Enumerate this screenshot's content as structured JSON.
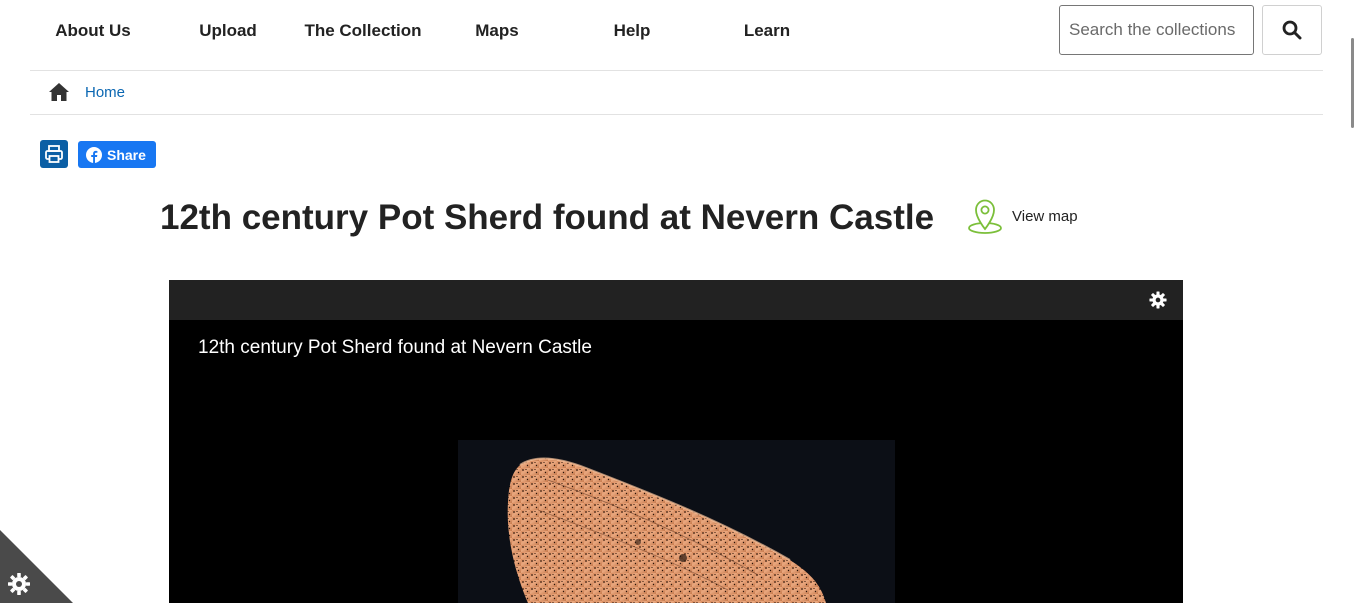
{
  "nav": {
    "items": [
      {
        "label": "About Us"
      },
      {
        "label": "Upload"
      },
      {
        "label": "The Collection"
      },
      {
        "label": "Maps"
      },
      {
        "label": "Help"
      },
      {
        "label": "Learn"
      }
    ]
  },
  "search": {
    "placeholder": "Search the collections",
    "value": ""
  },
  "breadcrumb": {
    "home_label": "Home"
  },
  "share": {
    "facebook_label": "Share"
  },
  "page": {
    "title": "12th century Pot Sherd found at Nevern Castle",
    "view_map_label": "View map"
  },
  "viewer": {
    "caption": "12th century Pot Sherd found at Nevern Castle"
  },
  "colors": {
    "link": "#0b67b2",
    "print_button": "#0b5fa5",
    "facebook": "#1877f2",
    "map_pin": "#7bbf3a",
    "viewer_bar": "#222222",
    "cookie_corner": "#4a4a4a"
  },
  "icons": [
    "search-icon",
    "home-icon",
    "print-icon",
    "facebook-icon",
    "map-pin-icon",
    "gear-icon",
    "cookie-settings-icon"
  ]
}
